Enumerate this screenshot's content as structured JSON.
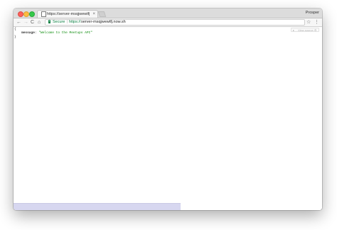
{
  "window": {
    "tab": {
      "title": "https://server-msqjwewtfj.now.sh",
      "close": "×"
    },
    "profile": "Prosper"
  },
  "toolbar": {
    "back": "←",
    "forward": "→",
    "reload": "C",
    "home": "⌂",
    "secure_label": "Secure",
    "separator": "|",
    "url_scheme": "https://",
    "url_host": "server-msqjwewtfj.now.sh",
    "star": "☆",
    "menu": "⋮"
  },
  "content": {
    "open_brace": "{",
    "close_brace": "}",
    "json": {
      "key": "message",
      "colon": ":",
      "value": "\"Welcome to the Meetups API\""
    },
    "view_source": {
      "toggle": "▸",
      "label": "View source ⚙"
    }
  },
  "colors": {
    "secure_green": "#0b8043",
    "json_string_green": "#0a8a0a"
  },
  "icons": [
    "back-arrow-icon",
    "forward-arrow-icon",
    "reload-icon",
    "home-icon",
    "lock-icon",
    "star-icon",
    "menu-icon",
    "page-icon",
    "close-icon"
  ]
}
